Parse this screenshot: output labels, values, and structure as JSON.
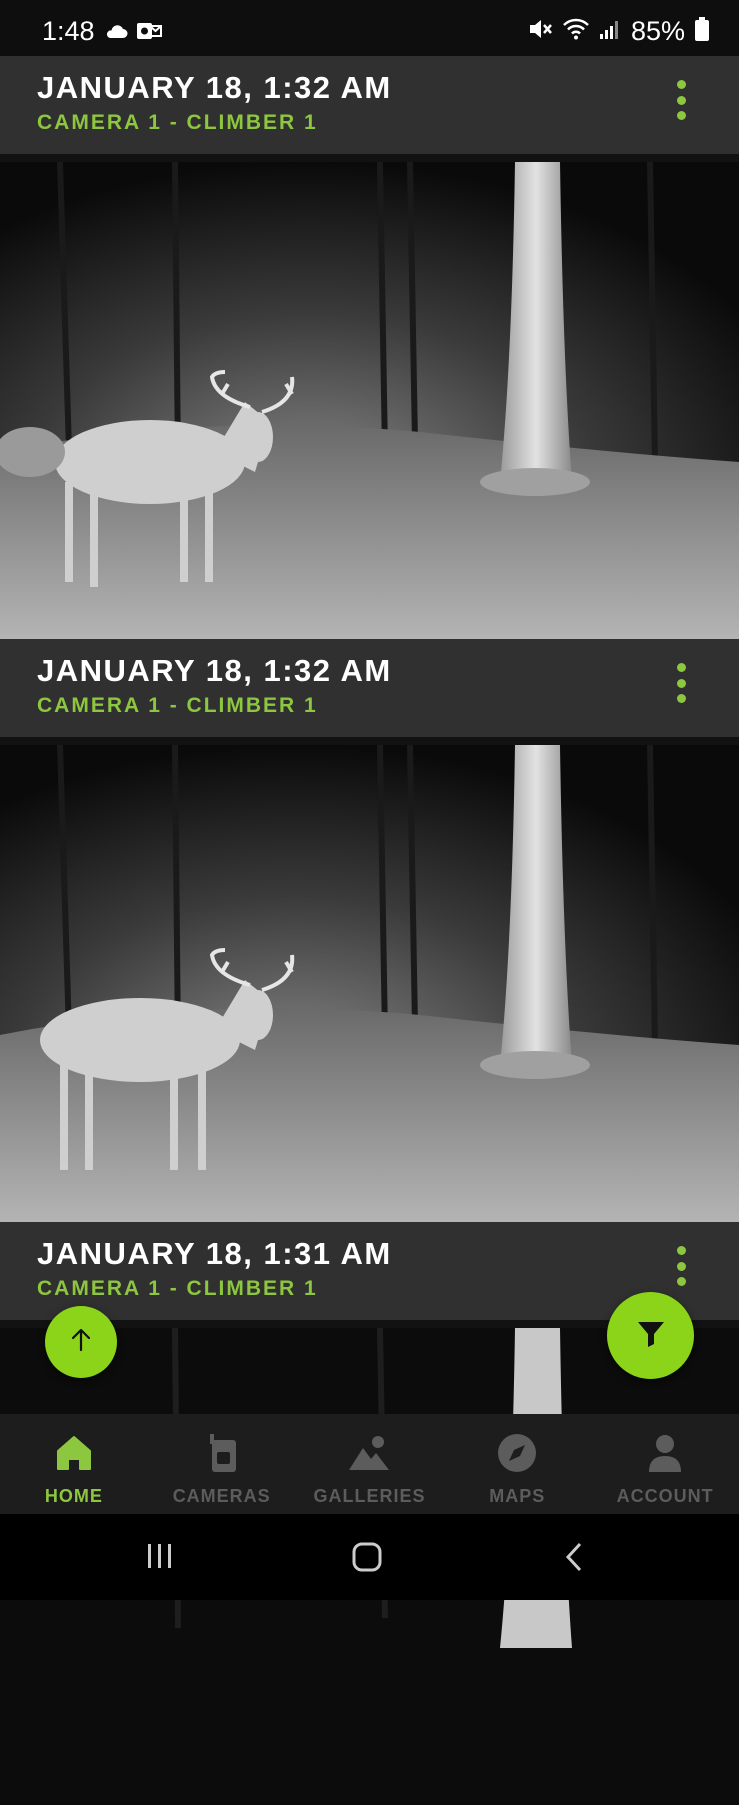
{
  "status_bar": {
    "time": "1:48",
    "battery": "85%",
    "left_icons": [
      "cloud-icon",
      "outlook-icon"
    ],
    "right_icons": [
      "mute-icon",
      "wifi-icon",
      "signal-icon",
      "battery-icon"
    ]
  },
  "photos": [
    {
      "date": "JANUARY 18, 1:32 AM",
      "camera": "CAMERA 1 - CLIMBER 1"
    },
    {
      "date": "JANUARY 18, 1:32 AM",
      "camera": "CAMERA 1 - CLIMBER 1"
    },
    {
      "date": "JANUARY 18, 1:31 AM",
      "camera": "CAMERA 1 - CLIMBER 1"
    }
  ],
  "fab": {
    "scroll_top_icon": "arrow-up-icon",
    "filter_icon": "filter-icon"
  },
  "nav": {
    "items": [
      {
        "label": "HOME",
        "icon": "home-icon",
        "active": true
      },
      {
        "label": "CAMERAS",
        "icon": "camera-icon",
        "active": false
      },
      {
        "label": "GALLERIES",
        "icon": "mountain-icon",
        "active": false
      },
      {
        "label": "MAPS",
        "icon": "compass-icon",
        "active": false
      },
      {
        "label": "ACCOUNT",
        "icon": "person-icon",
        "active": false
      }
    ]
  },
  "colors": {
    "accent": "#8dc63f",
    "fab": "#8bd41a",
    "header_bg": "#303030",
    "nav_bg": "#1d1d1d"
  }
}
